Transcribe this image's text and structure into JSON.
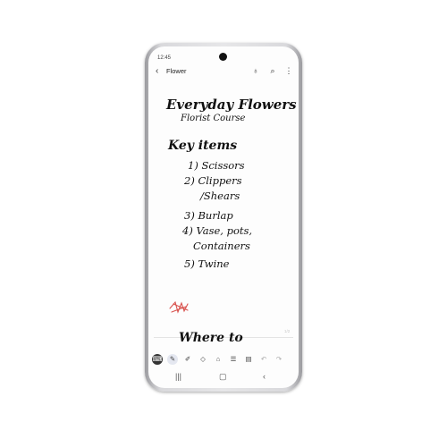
{
  "status_bar": {
    "time": "12:45"
  },
  "header": {
    "back_icon": "chevron-left-icon",
    "title": "Flower",
    "actions": [
      "bookmark-icon",
      "attach-icon",
      "more-vert-icon"
    ]
  },
  "note": {
    "title": "Everyday Flowers",
    "subtitle": "Florist Course",
    "heading": "Key items",
    "items": [
      "1) Scissors",
      "2) Clippers",
      "/Shears",
      "3) Burlap",
      "4) Vase, pots,",
      "Containers",
      "5) Twine"
    ],
    "page_number": "1/2",
    "next_heading": "Where to",
    "scribble_color": "#d9534f"
  },
  "toolbar": {
    "tools": [
      "keyboard-icon",
      "pen-icon",
      "highlighter-icon",
      "eraser-icon",
      "shape-icon",
      "text-format-icon",
      "insert-icon",
      "undo-icon",
      "redo-icon"
    ]
  },
  "nav": {
    "buttons": [
      "recents-icon",
      "home-icon",
      "back-icon"
    ]
  }
}
